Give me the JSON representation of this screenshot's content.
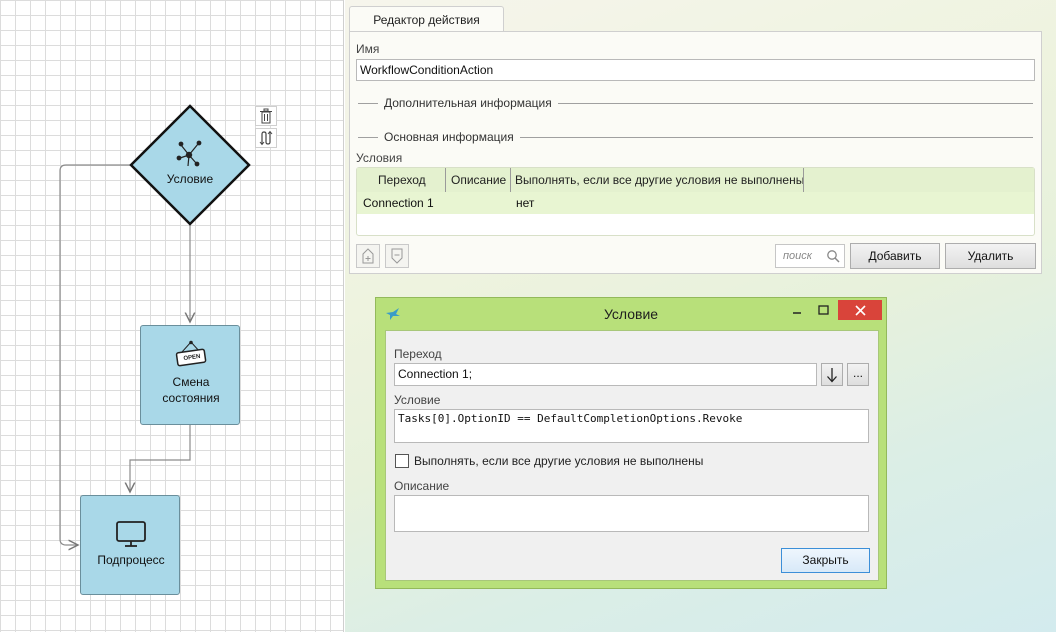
{
  "canvas": {
    "nodes": {
      "condition": "Условие",
      "state_change_line1": "Смена",
      "state_change_line2": "состояния",
      "state_change_sign": "OPEN",
      "subprocess": "Подпроцесс"
    }
  },
  "editor": {
    "tab": "Редактор действия",
    "name_label": "Имя",
    "name_value": "WorkflowConditionAction",
    "section_extra": "Дополнительная информация",
    "section_main": "Основная информация",
    "conditions_label": "Условия",
    "grid": {
      "columns": [
        "Переход",
        "Описание",
        "Выполнять, если все другие условия не выполнены"
      ],
      "rows": [
        {
          "transition": "Connection 1",
          "description": "",
          "fallback": "нет"
        }
      ]
    },
    "search_placeholder": "поиск",
    "add_button": "Добавить",
    "delete_button": "Удалить"
  },
  "dialog": {
    "title": "Условие",
    "transition_label": "Переход",
    "transition_value": "Connection 1;",
    "ellipsis": "...",
    "condition_label": "Условие",
    "condition_value": "Tasks[0].OptionID == DefaultCompletionOptions.Revoke",
    "checkbox_label": "Выполнять, если все другие условия не выполнены",
    "checkbox_checked": false,
    "description_label": "Описание",
    "description_value": "",
    "close_button": "Закрыть"
  },
  "colors": {
    "node_fill": "#a9d8e8",
    "grid_header": "#e4f1cf",
    "grid_row_selected": "#e8f5d2",
    "dialog_frame": "#b8e07a",
    "close_red": "#d9443a"
  }
}
